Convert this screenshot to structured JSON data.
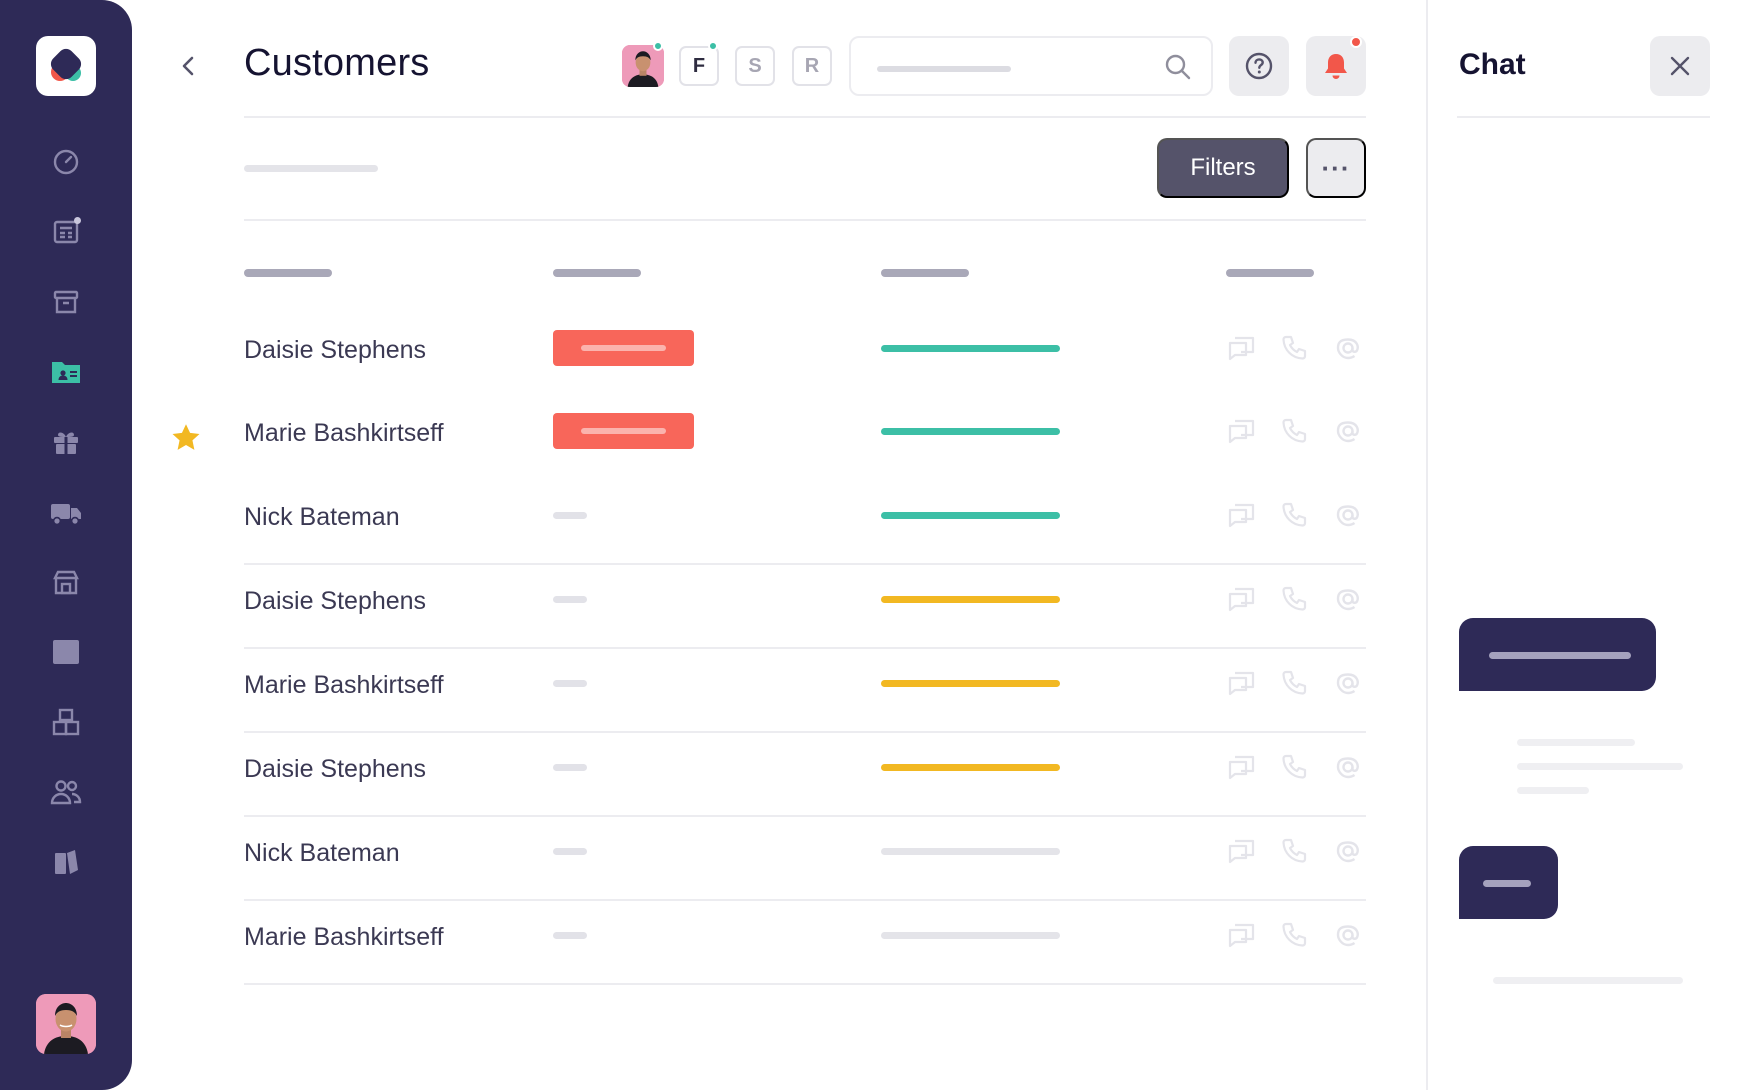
{
  "sidebar": {
    "logo_icon": "app-logo-icon",
    "items": [
      {
        "icon": "dashboard-gauge-icon",
        "active": false,
        "has_dot": false
      },
      {
        "icon": "newspaper-icon",
        "active": false,
        "has_dot": true
      },
      {
        "icon": "archive-box-icon",
        "active": false,
        "has_dot": false
      },
      {
        "icon": "customer-folder-icon",
        "active": true,
        "has_dot": false
      },
      {
        "icon": "gift-icon",
        "active": false,
        "has_dot": false
      },
      {
        "icon": "delivery-truck-icon",
        "active": false,
        "has_dot": false
      },
      {
        "icon": "store-icon",
        "active": false,
        "has_dot": false
      },
      {
        "icon": "square-icon",
        "active": false,
        "has_dot": false
      },
      {
        "icon": "boxes-icon",
        "active": false,
        "has_dot": false
      },
      {
        "icon": "users-icon",
        "active": false,
        "has_dot": false
      },
      {
        "icon": "books-icon",
        "active": false,
        "has_dot": false
      }
    ]
  },
  "header": {
    "title": "Customers",
    "collaborators": [
      "F",
      "S",
      "R"
    ],
    "search_placeholder": ""
  },
  "toolbar": {
    "filters_label": "Filters",
    "more_label": "···"
  },
  "table": {
    "rows": [
      {
        "name": "Daisie Stephens",
        "starred": false,
        "badge": true,
        "bar": "teal"
      },
      {
        "name": "Marie Bashkirtseff",
        "starred": true,
        "badge": true,
        "bar": "teal"
      },
      {
        "name": "Nick Bateman",
        "starred": false,
        "badge": false,
        "bar": "teal"
      },
      {
        "name": "Daisie Stephens",
        "starred": false,
        "badge": false,
        "bar": "yellow"
      },
      {
        "name": "Marie Bashkirtseff",
        "starred": false,
        "badge": false,
        "bar": "yellow"
      },
      {
        "name": "Daisie Stephens",
        "starred": false,
        "badge": false,
        "bar": "yellow"
      },
      {
        "name": "Nick Bateman",
        "starred": false,
        "badge": false,
        "bar": "gray"
      },
      {
        "name": "Marie Bashkirtseff",
        "starred": false,
        "badge": false,
        "bar": "gray"
      }
    ]
  },
  "chat": {
    "title": "Chat"
  },
  "colors": {
    "sidebar_bg": "#2e2a57",
    "accent_teal": "#3cbfa6",
    "accent_yellow": "#f2b822",
    "accent_red": "#f8665a",
    "neutral_bar": "#e4e4e9",
    "star": "#f2b822"
  }
}
